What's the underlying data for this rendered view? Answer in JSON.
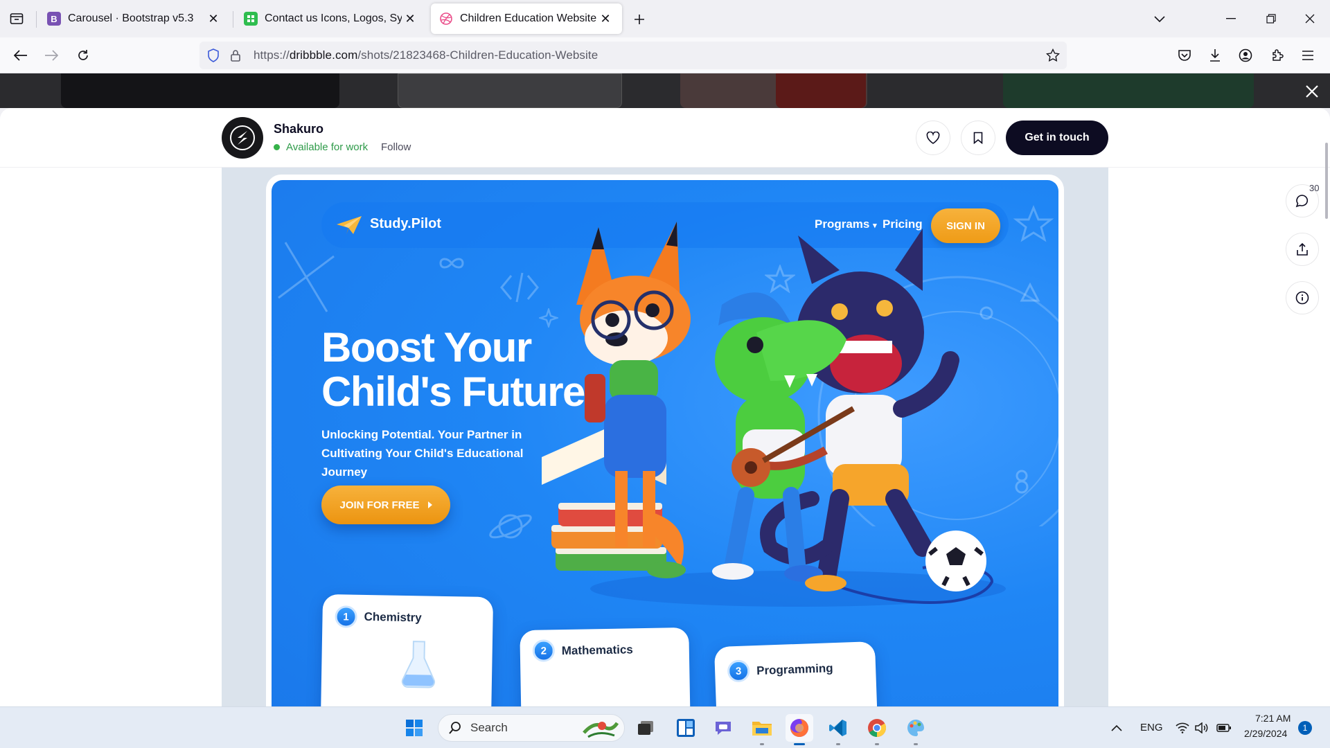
{
  "browser": {
    "tabs": [
      {
        "title": "Carousel · Bootstrap v5.3",
        "favicon_letter": "B",
        "favicon_color": "#7952b3",
        "active": false
      },
      {
        "title": "Contact us Icons, Logos, Symbo",
        "favicon_letter": "",
        "favicon_color": "#2fbd4f",
        "active": false
      },
      {
        "title": "Children Education Website by",
        "favicon_letter": "",
        "favicon_color": "#ea4c89",
        "active": true
      }
    ],
    "url_scheme": "https://",
    "url_domain": "dribbble.com",
    "url_path": "/shots/21823468-Children-Education-Website"
  },
  "shot_header": {
    "designer_name": "Shakuro",
    "availability": "Available for work",
    "follow_label": "Follow",
    "cta_label": "Get in touch",
    "comment_count": "30"
  },
  "shot": {
    "brand": "Study.Pilot",
    "nav_programs": "Programs",
    "nav_pricing": "Pricing",
    "signin_label": "SIGN IN",
    "hero_title_line1": "Boost Your",
    "hero_title_line2": "Child's Future",
    "hero_subtitle": "Unlocking Potential. Your Partner in Cultivating Your Child's Educational Journey",
    "join_label": "JOIN FOR FREE",
    "subjects": [
      {
        "number": "1",
        "label": "Chemistry"
      },
      {
        "number": "2",
        "label": "Mathematics"
      },
      {
        "number": "3",
        "label": "Programming"
      }
    ]
  },
  "taskbar": {
    "search_label": "Search",
    "language": "ENG",
    "time": "7:21 AM",
    "date": "2/29/2024",
    "notification_count": "1"
  },
  "colors": {
    "brand_dark": "#0d0c22",
    "available_green": "#2f9b4a",
    "hero_blue": "#1f86f5",
    "accent_orange": "#f2a224"
  }
}
